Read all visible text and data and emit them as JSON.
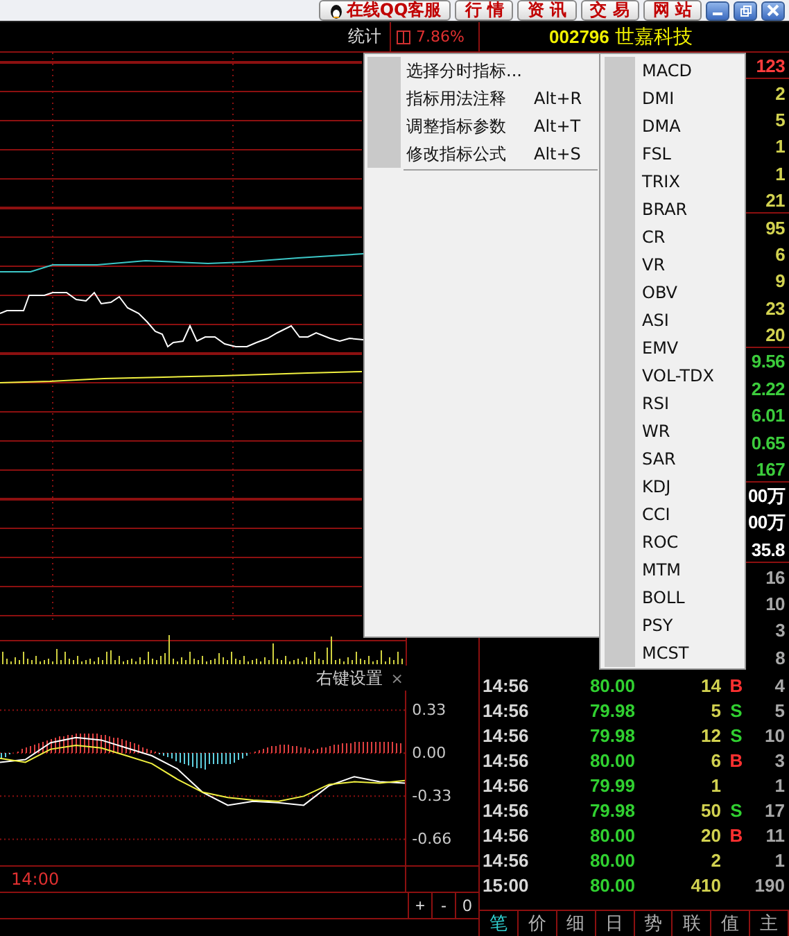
{
  "toolbar": {
    "service": "在线QQ客服",
    "buttons": [
      "行 情",
      "资 讯",
      "交 易",
      "网 站"
    ]
  },
  "chart_header": {
    "label": "统计",
    "change": "7.86%"
  },
  "stock": {
    "code": "002796",
    "name": "世嘉科技"
  },
  "quote_values": [
    {
      "text": "123",
      "color": "#ff3c3c"
    },
    {
      "text": "2",
      "color": "#d2d250"
    },
    {
      "text": "5",
      "color": "#d2d250"
    },
    {
      "text": "1",
      "color": "#d2d250"
    },
    {
      "text": "1",
      "color": "#d2d250"
    },
    {
      "text": "21",
      "color": "#d2d250"
    },
    {
      "text": "95",
      "color": "#d2d250"
    },
    {
      "text": "6",
      "color": "#d2d250"
    },
    {
      "text": "9",
      "color": "#d2d250"
    },
    {
      "text": "23",
      "color": "#d2d250"
    },
    {
      "text": "20",
      "color": "#d2d250"
    },
    {
      "text": "9.56",
      "color": "#3ccc3c"
    },
    {
      "text": "2.22",
      "color": "#3ccc3c"
    },
    {
      "text": "6.01",
      "color": "#3ccc3c"
    },
    {
      "text": "0.65",
      "color": "#3ccc3c"
    },
    {
      "text": "167",
      "color": "#3ccc3c"
    },
    {
      "text": "00万",
      "color": "#ffffff"
    },
    {
      "text": "00万",
      "color": "#ffffff"
    },
    {
      "text": "35.8",
      "color": "#ffffff"
    },
    {
      "text": "16",
      "color": "#a8a8a8"
    },
    {
      "text": "10",
      "color": "#a8a8a8"
    },
    {
      "text": "3",
      "color": "#a8a8a8"
    },
    {
      "text": "8",
      "color": "#a8a8a8"
    }
  ],
  "context_menu": {
    "items": [
      {
        "label": "选择分时指标..."
      },
      {
        "label": "指标用法注释",
        "shortcut": "Alt+R"
      },
      {
        "label": "调整指标参数",
        "shortcut": "Alt+T"
      },
      {
        "label": "修改指标公式",
        "shortcut": "Alt+S"
      }
    ]
  },
  "indicator_menu": {
    "items": [
      "MACD",
      "DMI",
      "DMA",
      "FSL",
      "TRIX",
      "BRAR",
      "CR",
      "VR",
      "OBV",
      "ASI",
      "EMV",
      "VOL-TDX",
      "RSI",
      "WR",
      "SAR",
      "KDJ",
      "CCI",
      "ROC",
      "MTM",
      "BOLL",
      "PSY",
      "MCST"
    ]
  },
  "macd_panel": {
    "title": "右键设置",
    "close": "×",
    "time_label": "14:00",
    "zoom_buttons": [
      "+",
      "-",
      "0"
    ],
    "chart_data": {
      "type": "line",
      "grid": true,
      "ylim": [
        -0.86,
        0.48
      ],
      "yticks": [
        {
          "value": 0.33,
          "label": "0.33"
        },
        {
          "value": 0,
          "label": "0.00"
        },
        {
          "value": -0.33,
          "label": "-0.33"
        },
        {
          "value": -0.66,
          "label": "-0.66"
        }
      ],
      "series": [
        {
          "color": "#ffffff",
          "values": [
            -0.07,
            -0.05,
            0.08,
            0.12,
            0.1,
            0.04,
            -0.02,
            -0.12,
            -0.3,
            -0.4,
            -0.37,
            -0.38,
            -0.4,
            -0.25,
            -0.18,
            -0.22,
            -0.23
          ]
        },
        {
          "color": "#f0f040",
          "values": [
            -0.04,
            -0.07,
            0.03,
            0.06,
            0.04,
            -0.02,
            -0.08,
            -0.2,
            -0.3,
            -0.34,
            -0.36,
            -0.37,
            -0.33,
            -0.24,
            -0.22,
            -0.23,
            -0.21
          ]
        }
      ]
    }
  },
  "trades": [
    {
      "time": "14:56",
      "price": "80.00",
      "volume": "14",
      "side": {
        "label": "B",
        "kind": "buy"
      },
      "count": "4"
    },
    {
      "time": "14:56",
      "price": "79.98",
      "volume": "5",
      "side": {
        "label": "S",
        "kind": "sell"
      },
      "count": "5"
    },
    {
      "time": "14:56",
      "price": "79.98",
      "volume": "12",
      "side": {
        "label": "S",
        "kind": "sell"
      },
      "count": "10"
    },
    {
      "time": "14:56",
      "price": "80.00",
      "volume": "6",
      "side": {
        "label": "B",
        "kind": "buy"
      },
      "count": "3"
    },
    {
      "time": "14:56",
      "price": "79.99",
      "volume": "1",
      "count": "1"
    },
    {
      "time": "14:56",
      "price": "79.98",
      "volume": "50",
      "side": {
        "label": "S",
        "kind": "sell"
      },
      "count": "17"
    },
    {
      "time": "14:56",
      "price": "80.00",
      "volume": "20",
      "side": {
        "label": "B",
        "kind": "buy"
      },
      "count": "11"
    },
    {
      "time": "14:56",
      "price": "80.00",
      "volume": "2",
      "count": "1"
    },
    {
      "time": "15:00",
      "price": "80.00",
      "volume": "410",
      "count": "190"
    }
  ],
  "bottom_tabs": [
    {
      "label": "笔",
      "selected": true
    },
    {
      "label": "价",
      "selected": false
    },
    {
      "label": "细",
      "selected": false
    },
    {
      "label": "日",
      "selected": false
    },
    {
      "label": "势",
      "selected": false
    },
    {
      "label": "联",
      "selected": false
    },
    {
      "label": "值",
      "selected": false
    },
    {
      "label": "主",
      "selected": false
    }
  ]
}
